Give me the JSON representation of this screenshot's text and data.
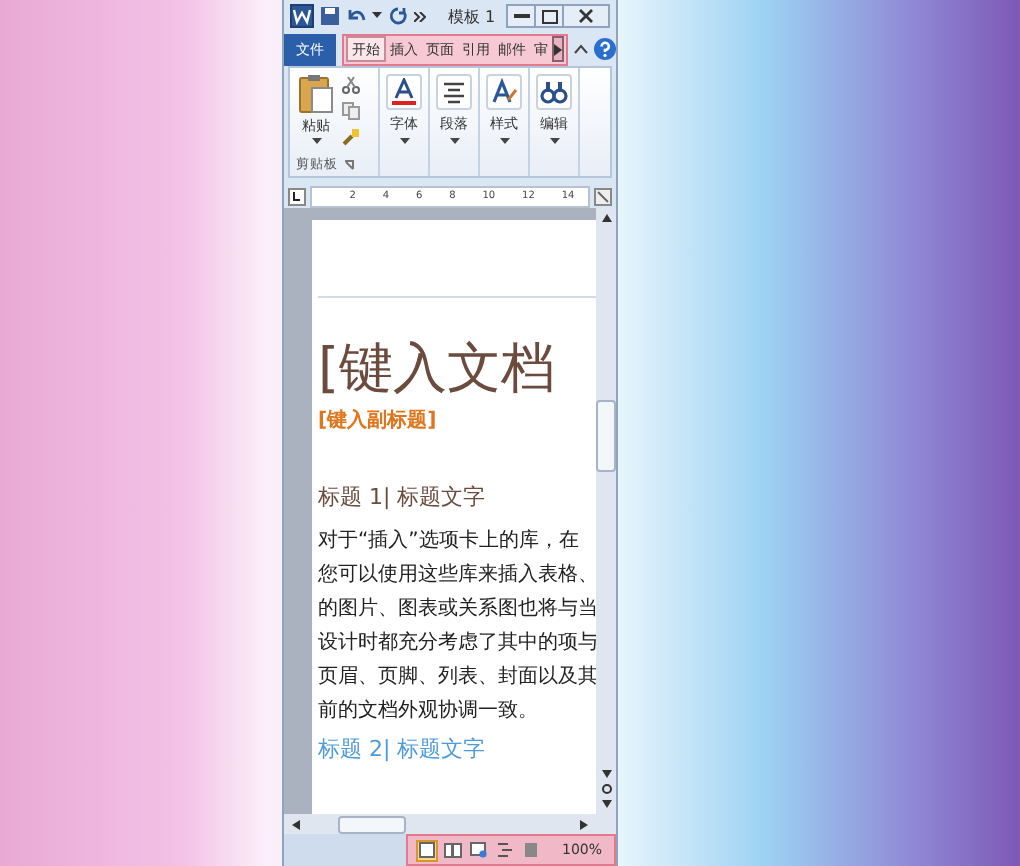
{
  "window": {
    "title": "模板 1"
  },
  "ribbon": {
    "file_tab": "文件",
    "tabs": [
      {
        "label": "开始",
        "selected": true
      },
      {
        "label": "插入",
        "selected": false
      },
      {
        "label": "页面",
        "selected": false
      },
      {
        "label": "引用",
        "selected": false
      },
      {
        "label": "邮件",
        "selected": false
      },
      {
        "label": "审",
        "selected": false
      }
    ],
    "groups": [
      {
        "kind": "clipboard",
        "label": "粘贴",
        "group_label": "剪贴板"
      },
      {
        "kind": "font",
        "label": "字体"
      },
      {
        "kind": "paragraph",
        "label": "段落"
      },
      {
        "kind": "styles",
        "label": "样式"
      },
      {
        "kind": "editing",
        "label": "编辑"
      }
    ]
  },
  "ruler": {
    "labels": [
      "2",
      "4",
      "6",
      "8",
      "10",
      "12",
      "14"
    ]
  },
  "document": {
    "title": "[键入文档",
    "subtitle": "[键入副标题]",
    "heading1": "标题 1| 标题文字",
    "paragraph_lines": [
      "对于“插入”选项卡上的库，在",
      "您可以使用这些库来插入表格、",
      "的图片、图表或关系图也将与当",
      "设计时都充分考虑了其中的项与",
      "页眉、页脚、列表、封面以及其",
      "前的文档外观协调一致。"
    ],
    "heading2": "标题 2| 标题文字"
  },
  "status_bar": {
    "views": [
      {
        "kind": "print",
        "selected": true
      },
      {
        "kind": "reading",
        "selected": false
      },
      {
        "kind": "web",
        "selected": false
      },
      {
        "kind": "outline",
        "selected": false
      },
      {
        "kind": "draft",
        "selected": false
      }
    ],
    "zoom": "100%"
  }
}
